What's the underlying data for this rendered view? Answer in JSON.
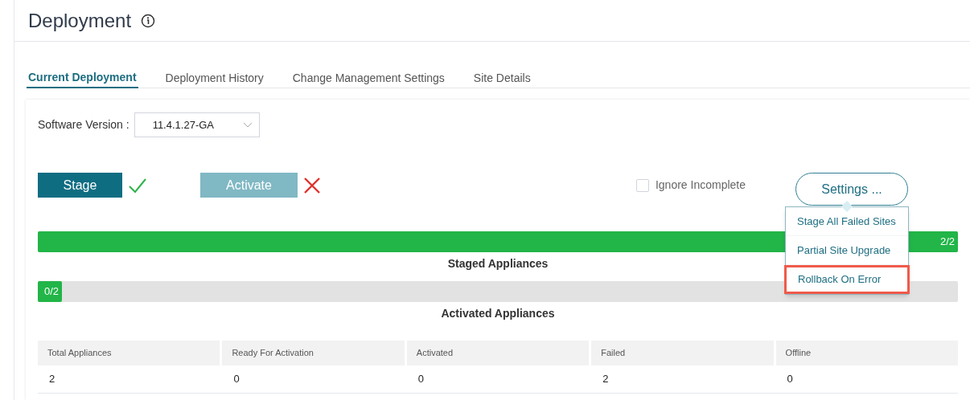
{
  "page": {
    "title": "Deployment"
  },
  "tabs": [
    {
      "label": "Current Deployment",
      "selected": true
    },
    {
      "label": "Deployment History",
      "selected": false
    },
    {
      "label": "Change Management Settings",
      "selected": false
    },
    {
      "label": "Site Details",
      "selected": false
    }
  ],
  "software_version": {
    "label": "Software Version :",
    "value": "11.4.1.27-GA"
  },
  "actions": [
    {
      "label": "Stage",
      "disabled": false,
      "passed": true
    },
    {
      "label": "Activate",
      "disabled": true,
      "passed": false
    }
  ],
  "ignore_incomplete": {
    "label": "Ignore Incomplete",
    "checked": false
  },
  "settings_button": {
    "label": "Settings ..."
  },
  "settings_menu": [
    {
      "label": "Stage All Failed Sites",
      "highlighted": false
    },
    {
      "label": "Partial Site Upgrade",
      "highlighted": false
    },
    {
      "label": "Rollback On Error",
      "highlighted": true
    }
  ],
  "progress": [
    {
      "reading": "2/2",
      "level": 1,
      "caption": "Staged Appliances"
    },
    {
      "reading": "0/2",
      "level": 0,
      "caption": "Activated Appliances"
    }
  ],
  "summary_table": {
    "columns": [
      "Total Appliances",
      "Ready For Activation",
      "Activated",
      "Failed",
      "Offline"
    ],
    "values": [
      "2",
      "0",
      "0",
      "2",
      "0"
    ]
  }
}
